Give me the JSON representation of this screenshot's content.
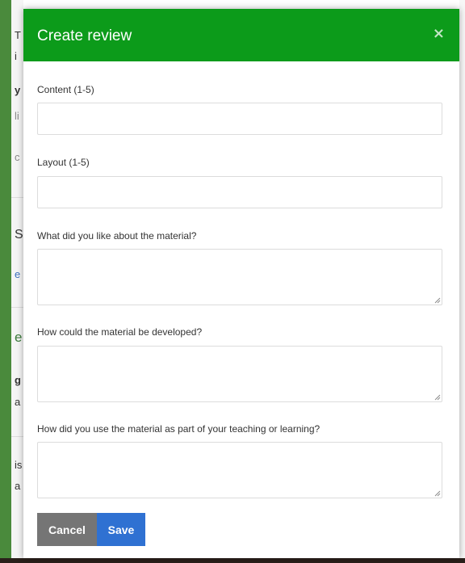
{
  "modal": {
    "title": "Create review",
    "close_glyph": "×",
    "close_icon": "close-icon"
  },
  "fields": {
    "content": {
      "label": "Content (1-5)",
      "value": "",
      "placeholder": ""
    },
    "layout": {
      "label": "Layout (1-5)",
      "value": "",
      "placeholder": ""
    },
    "liked": {
      "label": "What did you like about the material?",
      "value": "",
      "placeholder": ""
    },
    "developed": {
      "label": "How could the material be developed?",
      "value": "",
      "placeholder": ""
    },
    "usage": {
      "label": "How did you use the material as part of your teaching or learning?",
      "value": "",
      "placeholder": ""
    }
  },
  "buttons": {
    "cancel_label": "Cancel",
    "save_label": "Save"
  },
  "background": {
    "fragments": [
      "T",
      "i",
      "y",
      "li",
      "c",
      "S",
      "e",
      "e",
      "g",
      "a",
      "is",
      "a"
    ]
  },
  "colors": {
    "header": "#0c9b1a",
    "cancel": "#757575",
    "save": "#2f71d2"
  }
}
